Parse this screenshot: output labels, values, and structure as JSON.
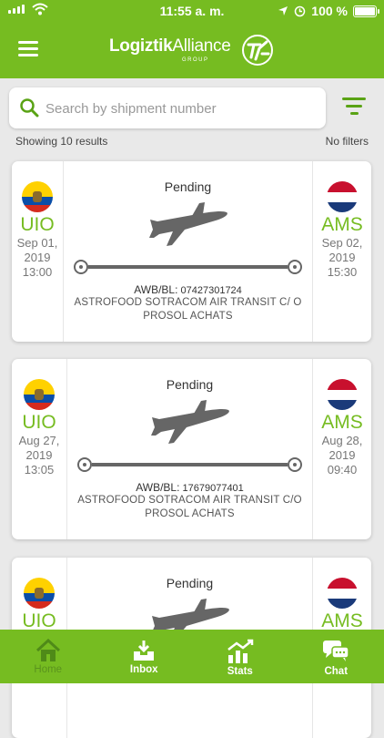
{
  "status_bar": {
    "time": "11:55 a. m.",
    "battery": "100 %"
  },
  "header": {
    "brand_bold": "Logiztik",
    "brand_light": "Alliance",
    "brand_group": "GROUP"
  },
  "search": {
    "placeholder": "Search by shipment number"
  },
  "summary": {
    "results": "Showing 10 results",
    "filters": "No filters"
  },
  "shipments": [
    {
      "status": "Pending",
      "origin": {
        "code": "UIO",
        "date": "Sep 01,",
        "year": "2019",
        "time": "13:00"
      },
      "destination": {
        "code": "AMS",
        "date": "Sep 02,",
        "year": "2019",
        "time": "15:30"
      },
      "awb_label": "AWB/BL:",
      "awb": "07427301724",
      "shipper": "ASTROFOOD SOTRACOM AIR TRANSIT C/ O PROSOL ACHATS"
    },
    {
      "status": "Pending",
      "origin": {
        "code": "UIO",
        "date": "Aug 27,",
        "year": "2019",
        "time": "13:05"
      },
      "destination": {
        "code": "AMS",
        "date": "Aug 28,",
        "year": "2019",
        "time": "09:40"
      },
      "awb_label": "AWB/BL:",
      "awb": "17679077401",
      "shipper": "ASTROFOOD SOTRACOM AIR TRANSIT C/O PROSOL ACHATS"
    },
    {
      "status": "Pending",
      "origin": {
        "code": "UIO"
      },
      "destination": {
        "code": "AMS"
      }
    }
  ],
  "tabs": [
    {
      "label": "Home",
      "icon": "home-icon",
      "active": true
    },
    {
      "label": "Inbox",
      "icon": "inbox-icon"
    },
    {
      "label": "Stats",
      "icon": "stats-icon"
    },
    {
      "label": "Chat",
      "icon": "chat-icon"
    }
  ],
  "colors": {
    "brand_green": "#76bc21",
    "route_gray": "#666666"
  }
}
